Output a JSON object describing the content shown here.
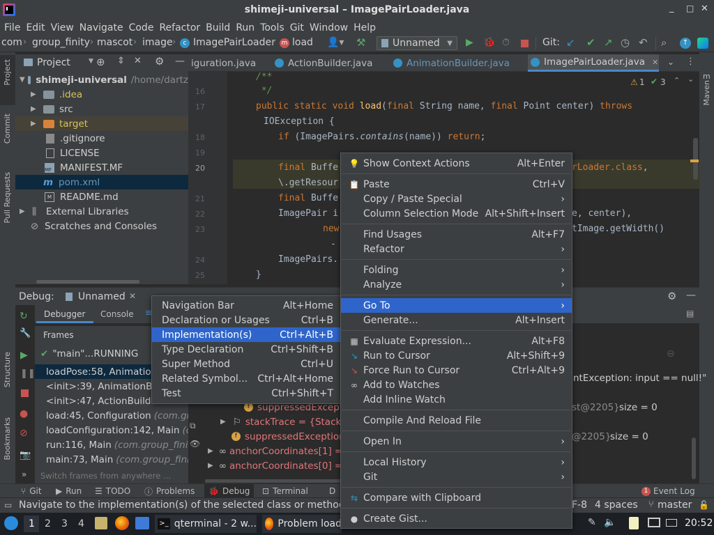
{
  "window": {
    "title": "shimeji-universal – ImagePairLoader.java",
    "minimize": "_",
    "maximize": "□",
    "close": "✕"
  },
  "menu": [
    "File",
    "Edit",
    "View",
    "Navigate",
    "Code",
    "Refactor",
    "Build",
    "Run",
    "Tools",
    "Git",
    "Window",
    "Help"
  ],
  "nav": {
    "crumbs": [
      "com",
      "group_finity",
      "mascot",
      "image",
      "ImagePairLoader",
      "load"
    ],
    "config": "Unnamed",
    "git_label": "Git:"
  },
  "project": {
    "header": "Project",
    "tree": [
      {
        "label": "shimeji-universal",
        "suffix": "/home/dartz"
      },
      {
        "label": ".idea"
      },
      {
        "label": "src"
      },
      {
        "label": "target"
      },
      {
        "label": ".gitignore"
      },
      {
        "label": "LICENSE"
      },
      {
        "label": "MANIFEST.MF"
      },
      {
        "label": "pom.xml"
      },
      {
        "label": "README.md"
      },
      {
        "label": "External Libraries"
      },
      {
        "label": "Scratches and Consoles"
      }
    ]
  },
  "left_tabs": [
    "Project",
    "Commit",
    "Pull Requests",
    "Structure",
    "Bookmarks"
  ],
  "right_tabs": [
    "Maven"
  ],
  "editor": {
    "tabs": [
      "iguration.java",
      "ActionBuilder.java",
      "AnimationBuilder.java",
      "ImagePairLoader.java"
    ],
    "warnings": "1",
    "checks": "3",
    "lines": [
      {
        "n": "",
        "text": "/**"
      },
      {
        "n": "16",
        "text": " */"
      },
      {
        "n": "17",
        "text": "public static void load(final String name, final Point center) throws"
      },
      {
        "n": "",
        "text": "IOException {"
      },
      {
        "n": "18",
        "text": "if (ImagePairs.contains(name)) return;"
      },
      {
        "n": "19",
        "text": ""
      },
      {
        "n": "20",
        "text": "final Buffe"
      },
      {
        "n": "",
        "text": "\\.getResour"
      },
      {
        "n": "21",
        "text": "final Buffe"
      },
      {
        "n": "22",
        "text": "ImagePair i"
      },
      {
        "n": "23",
        "text": "new"
      },
      {
        "n": "",
        "text": "-"
      },
      {
        "n": "24",
        "text": "ImagePairs."
      },
      {
        "n": "25",
        "text": "}"
      }
    ],
    "right_fragments": [
      "rLoader.class,",
      "e, center),",
      "tImage.getWidth()"
    ]
  },
  "debug": {
    "label": "Debug:",
    "config": "Unnamed",
    "tabs": [
      "Debugger",
      "Console"
    ],
    "frames_title": "Frames",
    "thread": "\"main\"...RUNNING",
    "frames": [
      {
        "method": "loadPose:58, Animation",
        "cls": ""
      },
      {
        "method": "<init>:39, AnimationBu",
        "cls": ""
      },
      {
        "method": "<init>:47, ActionBuilde",
        "cls": ""
      },
      {
        "method": "load:45, Configuration",
        "cls": "(com.gr"
      },
      {
        "method": "loadConfiguration:142, Main",
        "cls": "(c"
      },
      {
        "method": "run:116, Main",
        "cls": "(com.group_finit"
      },
      {
        "method": "main:73, Main",
        "cls": "(com.group_finit"
      }
    ],
    "frames_hint": "Switch frames from anywhere ...",
    "vars": {
      "suppressed1": "suppressedExcept",
      "stack": "stackTrace = {Stack",
      "suppressed2": "suppressedException",
      "anchor1": "anchorCoordinates[1] =",
      "anchor0": "anchorCoordinates[0] =",
      "exception_text": "ntException: input == null!\"",
      "ref1": "st@2205}",
      "size1": "size = 0",
      "ref2": "@2205}",
      "size2": "size = 0"
    }
  },
  "context_menu": [
    {
      "label": "Show Context Actions",
      "shortcut": "Alt+Enter",
      "icon": "bulb"
    },
    {
      "sep": true
    },
    {
      "label": "Paste",
      "shortcut": "Ctrl+V",
      "icon": "paste"
    },
    {
      "label": "Copy / Paste Special",
      "submenu": true
    },
    {
      "label": "Column Selection Mode",
      "shortcut": "Alt+Shift+Insert"
    },
    {
      "sep": true
    },
    {
      "label": "Find Usages",
      "shortcut": "Alt+F7"
    },
    {
      "label": "Refactor",
      "submenu": true
    },
    {
      "sep": true
    },
    {
      "label": "Folding",
      "submenu": true
    },
    {
      "label": "Analyze",
      "submenu": true
    },
    {
      "sep": true
    },
    {
      "label": "Go To",
      "submenu": true,
      "selected": true
    },
    {
      "label": "Generate...",
      "shortcut": "Alt+Insert"
    },
    {
      "sep": true
    },
    {
      "label": "Evaluate Expression...",
      "shortcut": "Alt+F8",
      "icon": "calc"
    },
    {
      "label": "Run to Cursor",
      "shortcut": "Alt+Shift+9",
      "icon": "run-cursor"
    },
    {
      "label": "Force Run to Cursor",
      "shortcut": "Ctrl+Alt+9",
      "icon": "force-run"
    },
    {
      "label": "Add to Watches",
      "icon": "watch"
    },
    {
      "label": "Add Inline Watch"
    },
    {
      "sep": true
    },
    {
      "label": "Compile And Reload File"
    },
    {
      "sep": true
    },
    {
      "label": "Open In",
      "submenu": true
    },
    {
      "sep": true
    },
    {
      "label": "Local History",
      "submenu": true
    },
    {
      "label": "Git",
      "submenu": true
    },
    {
      "sep": true
    },
    {
      "label": "Compare with Clipboard",
      "icon": "compare"
    },
    {
      "sep": true
    },
    {
      "label": "Create Gist...",
      "icon": "github"
    }
  ],
  "goto_menu": [
    {
      "label": "Navigation Bar",
      "shortcut": "Alt+Home"
    },
    {
      "label": "Declaration or Usages",
      "shortcut": "Ctrl+B"
    },
    {
      "label": "Implementation(s)",
      "shortcut": "Ctrl+Alt+B",
      "selected": true
    },
    {
      "label": "Type Declaration",
      "shortcut": "Ctrl+Shift+B"
    },
    {
      "label": "Super Method",
      "shortcut": "Ctrl+U"
    },
    {
      "label": "Related Symbol...",
      "shortcut": "Ctrl+Alt+Home"
    },
    {
      "label": "Test",
      "shortcut": "Ctrl+Shift+T"
    }
  ],
  "toolwindows": [
    "Git",
    "Run",
    "TODO",
    "Problems",
    "Debug",
    "Terminal",
    "D"
  ],
  "event_log": {
    "count": "1",
    "label": "Event Log"
  },
  "status": {
    "message": "Navigate to the implementation(s) of the selected class or method",
    "encoding": "F-8",
    "indent": "4 spaces",
    "branch": "master"
  },
  "taskbar": {
    "workspaces": [
      "1",
      "2",
      "3",
      "4"
    ],
    "windows": [
      "qterminal - 2 w...",
      "Problem load"
    ],
    "clock": "20:52"
  },
  "colors": {
    "accent": "#2f65ca",
    "run": "#59a869",
    "stop": "#c75450"
  }
}
